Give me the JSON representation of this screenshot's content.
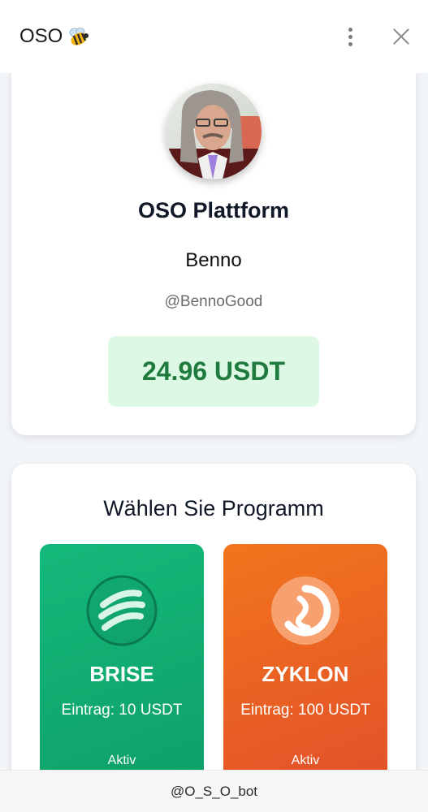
{
  "header": {
    "title": "OSO",
    "title_icon": "bee-emoji-icon",
    "menu_icon": "more-vertical-icon",
    "close_icon": "close-icon"
  },
  "profile": {
    "platform_title": "OSO Plattform",
    "name": "Benno",
    "handle": "@BennoGood",
    "balance": "24.96 USDT"
  },
  "programs": {
    "title": "Wählen Sie Programm",
    "items": [
      {
        "name": "BRISE",
        "entry": "Eintrag: 10 USDT",
        "status": "Aktiv",
        "color": "#12ad72",
        "icon": "wind-icon"
      },
      {
        "name": "ZYKLON",
        "entry": "Eintrag: 100 USDT",
        "status": "Aktiv",
        "color": "#ea6322",
        "icon": "cyclone-icon"
      }
    ]
  },
  "footer": {
    "bot_handle": "@O_S_O_bot"
  },
  "colors": {
    "balance_bg": "#ddf9e5",
    "balance_text": "#1f7a3e",
    "page_bg": "#f3f6f9"
  }
}
